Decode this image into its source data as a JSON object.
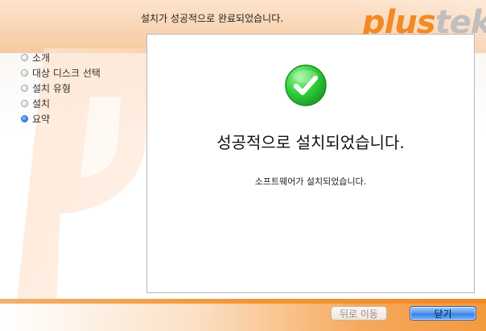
{
  "window": {
    "title": "설치가 성공적으로 완료되었습니다."
  },
  "brand": {
    "part1": "plus",
    "part2": "tek"
  },
  "steps": [
    {
      "label": "소개",
      "active": false
    },
    {
      "label": "대상 디스크 선택",
      "active": false
    },
    {
      "label": "설치 유형",
      "active": false
    },
    {
      "label": "설치",
      "active": false
    },
    {
      "label": "요약",
      "active": true
    }
  ],
  "content": {
    "icon": "checkmark-circle-icon",
    "title": "성공적으로 설치되었습니다.",
    "message": "소프트웨어가 설치되었습니다."
  },
  "buttons": {
    "back_label": "뒤로 이동",
    "close_label": "닫기"
  },
  "colors": {
    "brand_orange": "#f08a23",
    "success_green": "#2ecc40",
    "primary_button": "#3a82e6"
  }
}
